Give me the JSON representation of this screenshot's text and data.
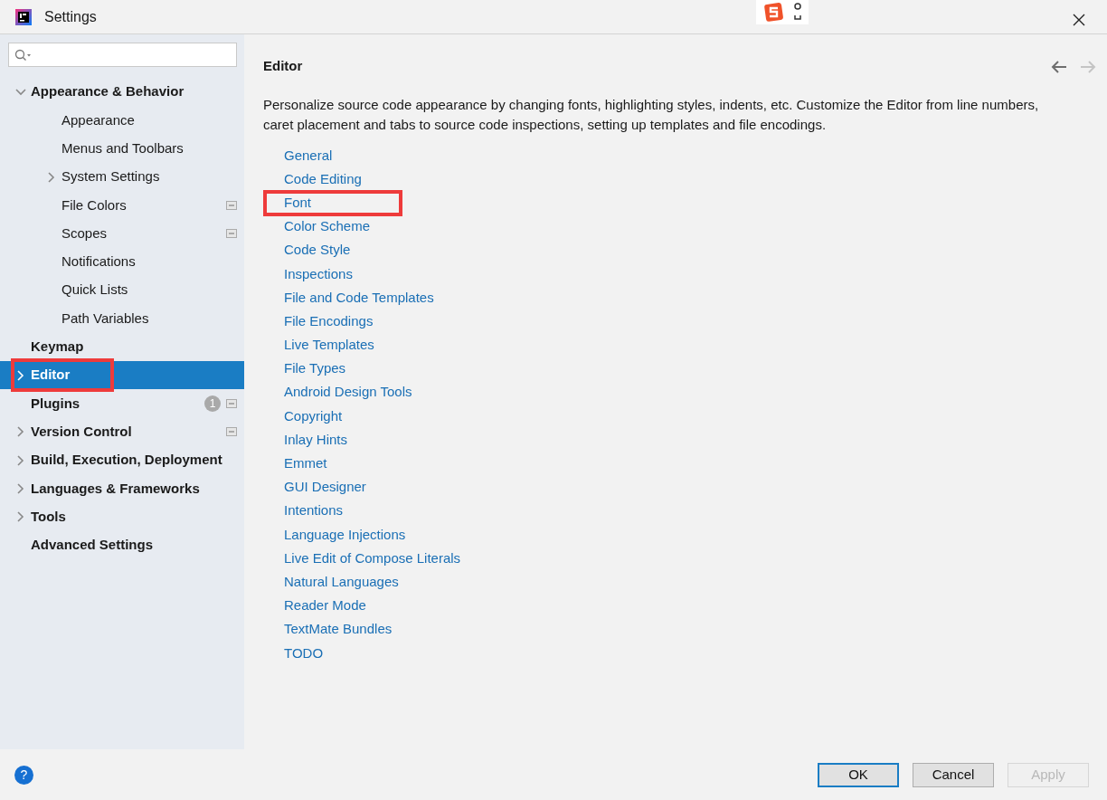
{
  "window": {
    "title": "Settings"
  },
  "sidebar": {
    "items": [
      {
        "label": "Appearance & Behavior",
        "expanded": true,
        "selected": false,
        "highlighted": false,
        "children": [
          {
            "label": "Appearance",
            "selected": false,
            "highlighted": false
          },
          {
            "label": "Menus and Toolbars",
            "selected": false,
            "highlighted": false
          },
          {
            "label": "System Settings",
            "expanded": false,
            "selected": false,
            "highlighted": false
          },
          {
            "label": "File Colors",
            "selected": false,
            "highlighted": false,
            "project_level": true
          },
          {
            "label": "Scopes",
            "selected": false,
            "highlighted": false,
            "project_level": true
          },
          {
            "label": "Notifications",
            "selected": false,
            "highlighted": false
          },
          {
            "label": "Quick Lists",
            "selected": false,
            "highlighted": false
          },
          {
            "label": "Path Variables",
            "selected": false,
            "highlighted": false
          }
        ]
      },
      {
        "label": "Keymap",
        "selected": false,
        "highlighted": false
      },
      {
        "label": "Editor",
        "expanded": false,
        "selected": true,
        "highlighted": true
      },
      {
        "label": "Plugins",
        "selected": false,
        "highlighted": false,
        "badge": "1",
        "project_level": true
      },
      {
        "label": "Version Control",
        "expanded": false,
        "selected": false,
        "highlighted": false,
        "project_level": true
      },
      {
        "label": "Build, Execution, Deployment",
        "expanded": false,
        "selected": false,
        "highlighted": false
      },
      {
        "label": "Languages & Frameworks",
        "expanded": false,
        "selected": false,
        "highlighted": false
      },
      {
        "label": "Tools",
        "expanded": false,
        "selected": false,
        "highlighted": false
      },
      {
        "label": "Advanced Settings",
        "selected": false,
        "highlighted": false
      }
    ]
  },
  "content": {
    "title": "Editor",
    "back_enabled": true,
    "forward_enabled": false,
    "description": "Personalize source code appearance by changing fonts, highlighting styles, indents, etc. Customize the Editor from line numbers, caret placement and tabs to source code inspections, setting up templates and file encodings.",
    "links": [
      {
        "label": "General",
        "highlighted": false
      },
      {
        "label": "Code Editing",
        "highlighted": false
      },
      {
        "label": "Font",
        "highlighted": true
      },
      {
        "label": "Color Scheme",
        "highlighted": false
      },
      {
        "label": "Code Style",
        "highlighted": false
      },
      {
        "label": "Inspections",
        "highlighted": false
      },
      {
        "label": "File and Code Templates",
        "highlighted": false
      },
      {
        "label": "File Encodings",
        "highlighted": false
      },
      {
        "label": "Live Templates",
        "highlighted": false
      },
      {
        "label": "File Types",
        "highlighted": false
      },
      {
        "label": "Android Design Tools",
        "highlighted": false
      },
      {
        "label": "Copyright",
        "highlighted": false
      },
      {
        "label": "Inlay Hints",
        "highlighted": false
      },
      {
        "label": "Emmet",
        "highlighted": false
      },
      {
        "label": "GUI Designer",
        "highlighted": false
      },
      {
        "label": "Intentions",
        "highlighted": false
      },
      {
        "label": "Language Injections",
        "highlighted": false
      },
      {
        "label": "Live Edit of Compose Literals",
        "highlighted": false
      },
      {
        "label": "Natural Languages",
        "highlighted": false
      },
      {
        "label": "Reader Mode",
        "highlighted": false
      },
      {
        "label": "TextMate Bundles",
        "highlighted": false
      },
      {
        "label": "TODO",
        "highlighted": false
      }
    ]
  },
  "footer": {
    "help": "?",
    "buttons": [
      {
        "label": "OK",
        "default": true,
        "disabled": false
      },
      {
        "label": "Cancel",
        "default": false,
        "disabled": false
      },
      {
        "label": "Apply",
        "default": false,
        "disabled": true
      }
    ]
  }
}
